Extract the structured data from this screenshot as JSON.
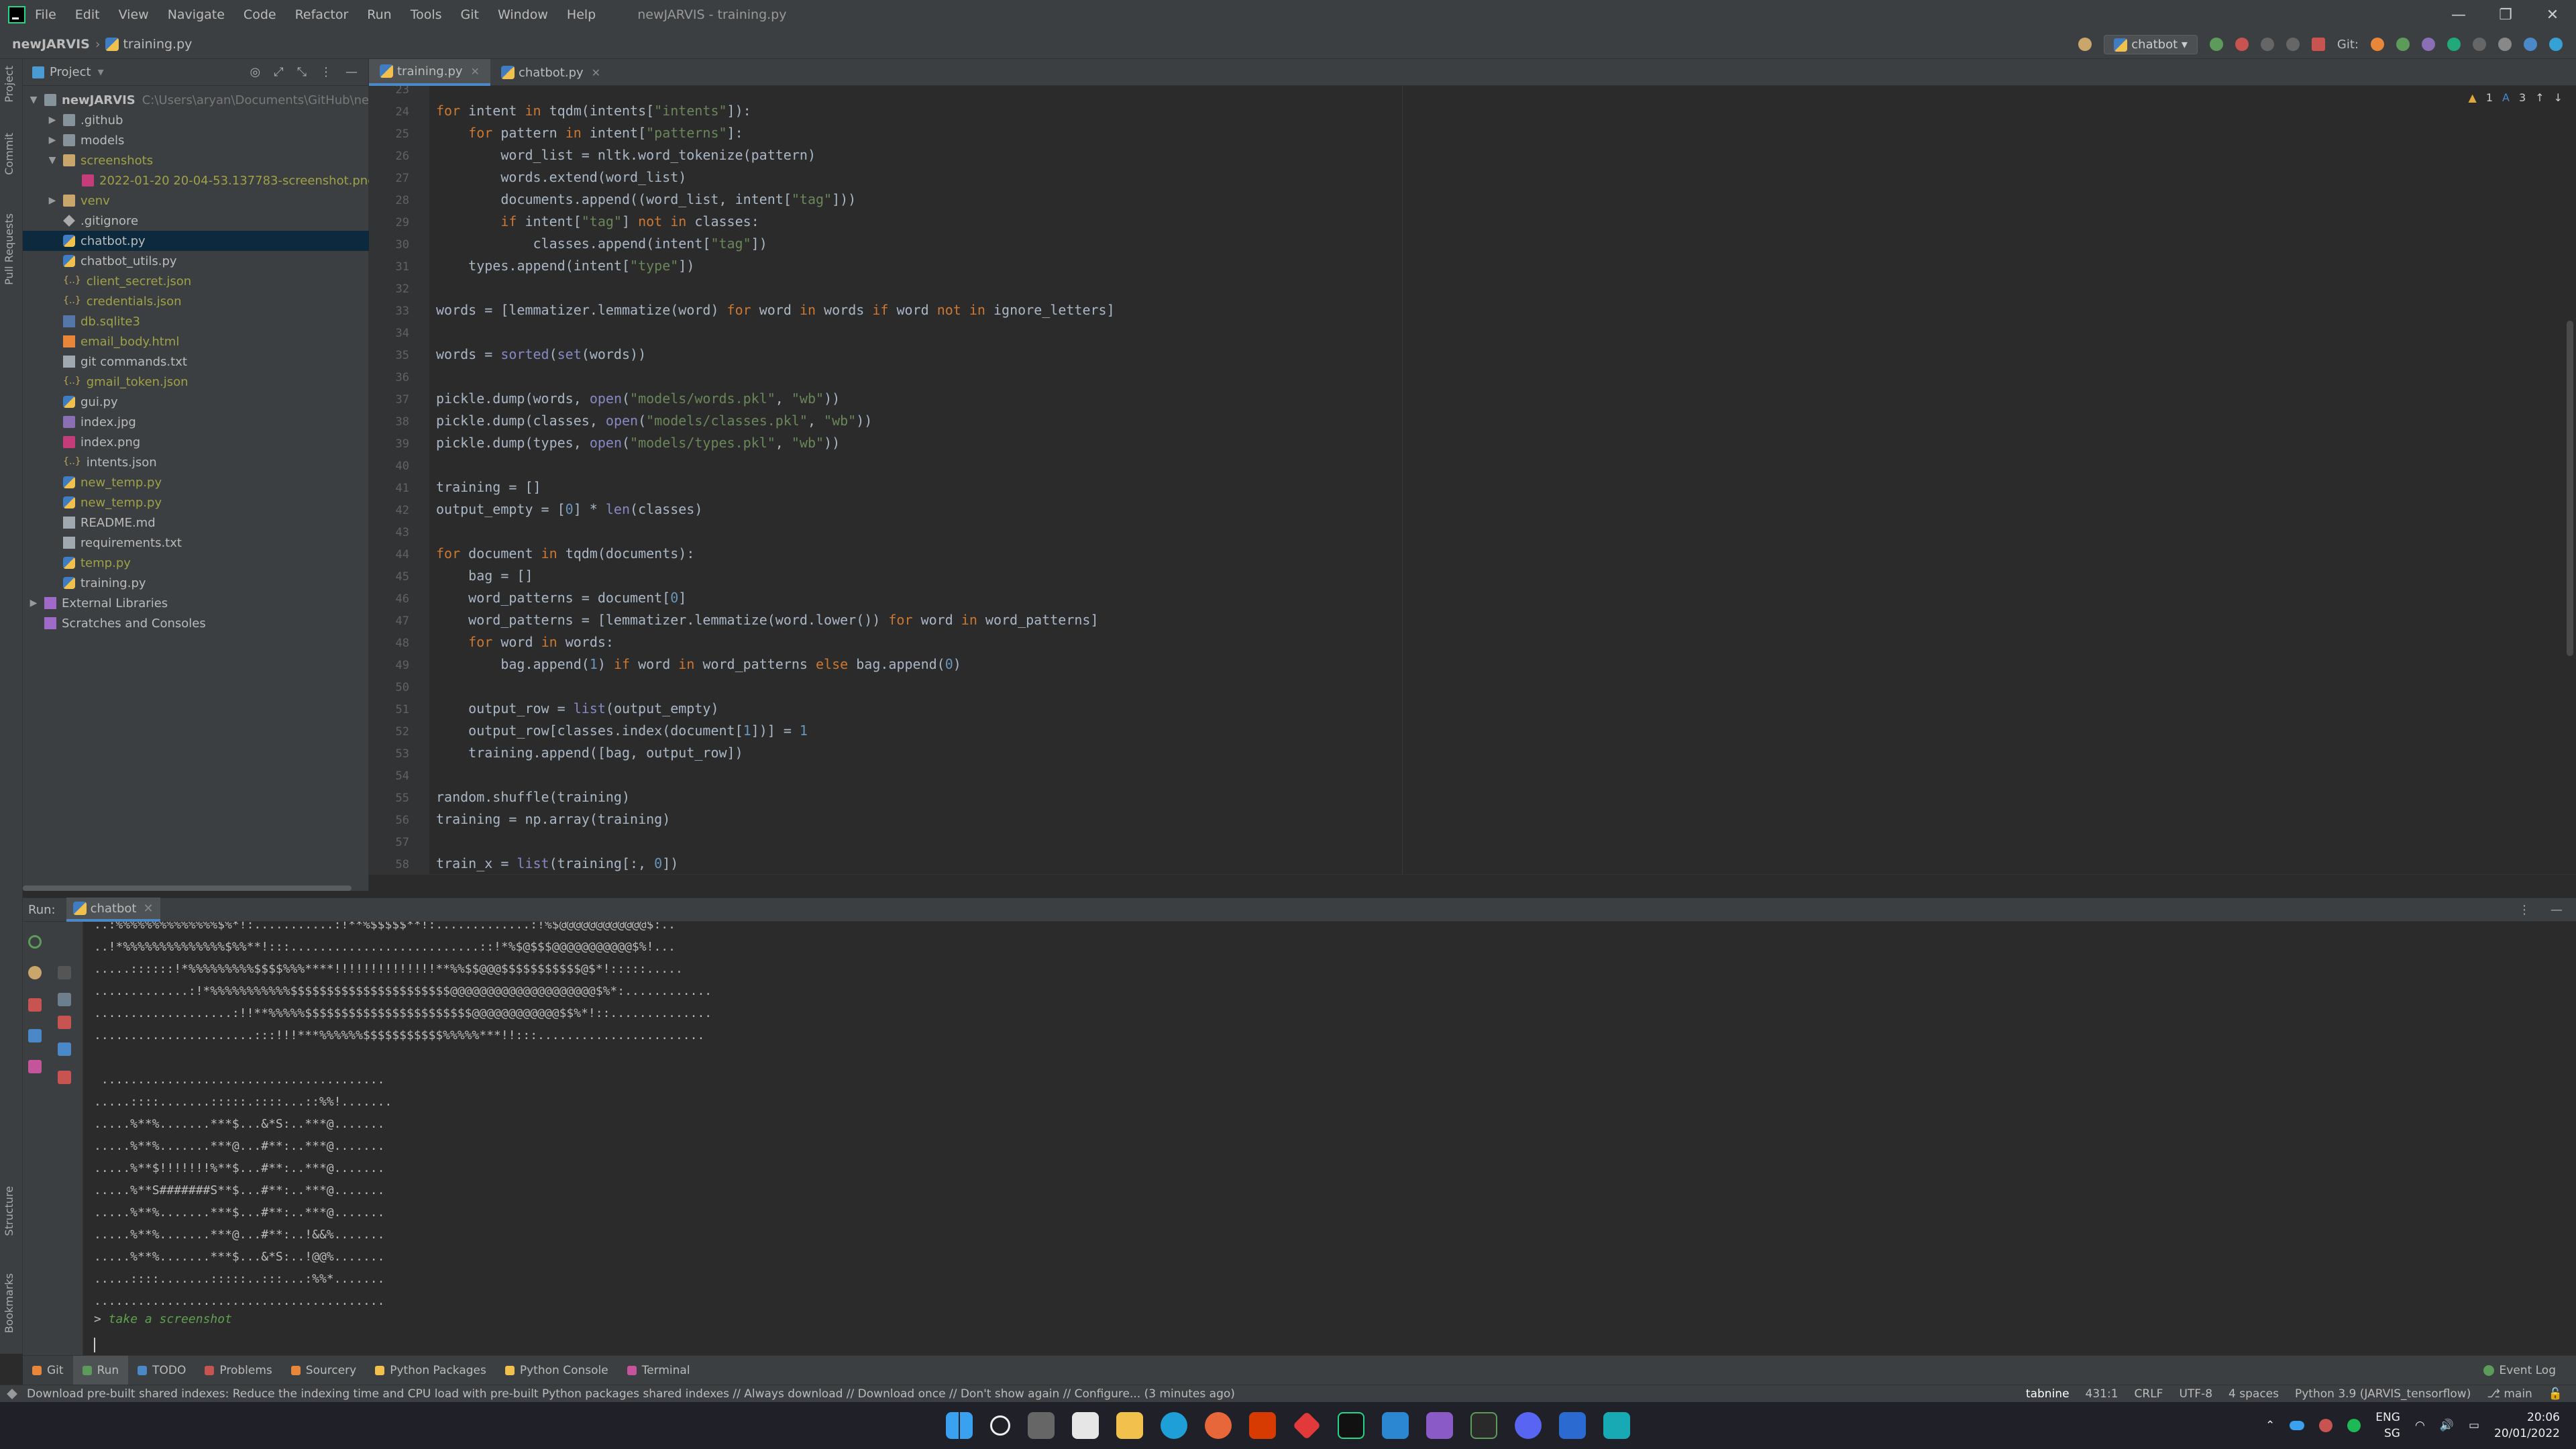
{
  "window": {
    "title": "newJARVIS - training.py",
    "menu": [
      "File",
      "Edit",
      "View",
      "Navigate",
      "Code",
      "Refactor",
      "Run",
      "Tools",
      "Git",
      "Window",
      "Help"
    ],
    "controls": [
      "—",
      "❐",
      "✕"
    ]
  },
  "navbar": {
    "project": "newJARVIS",
    "file": "training.py",
    "run_config": "chatbot",
    "git_label": "Git:"
  },
  "left_strip": [
    "Project",
    "Commit",
    "Pull Requests",
    "Structure",
    "Bookmarks"
  ],
  "project_panel": {
    "header": "Project",
    "tree": [
      {
        "label": "newJARVIS",
        "note": "C:\\Users\\aryan\\Documents\\GitHub\\newJARVIS",
        "indent": 0,
        "arrow": "▼",
        "icon": "folder",
        "style": "bold"
      },
      {
        "label": ".github",
        "indent": 1,
        "arrow": "▶",
        "icon": "folder"
      },
      {
        "label": "models",
        "indent": 1,
        "arrow": "▶",
        "icon": "folder"
      },
      {
        "label": "screenshots",
        "indent": 1,
        "arrow": "▼",
        "icon": "folder-orange",
        "style": "yellow"
      },
      {
        "label": "2022-01-20 20-04-53.137783-screenshot.png",
        "indent": 2,
        "arrow": "",
        "icon": "png",
        "style": "yellow"
      },
      {
        "label": "venv",
        "indent": 1,
        "arrow": "▶",
        "icon": "folder-orange",
        "style": "yellow"
      },
      {
        "label": ".gitignore",
        "indent": 1,
        "arrow": "",
        "icon": "git"
      },
      {
        "label": "chatbot.py",
        "indent": 1,
        "arrow": "",
        "icon": "py",
        "selected": true
      },
      {
        "label": "chatbot_utils.py",
        "indent": 1,
        "arrow": "",
        "icon": "py"
      },
      {
        "label": "client_secret.json",
        "indent": 1,
        "arrow": "",
        "icon": "json",
        "style": "yellow"
      },
      {
        "label": "credentials.json",
        "indent": 1,
        "arrow": "",
        "icon": "json",
        "style": "yellow"
      },
      {
        "label": "db.sqlite3",
        "indent": 1,
        "arrow": "",
        "icon": "db",
        "style": "yellow"
      },
      {
        "label": "email_body.html",
        "indent": 1,
        "arrow": "",
        "icon": "html",
        "style": "yellow"
      },
      {
        "label": "git commands.txt",
        "indent": 1,
        "arrow": "",
        "icon": "txt"
      },
      {
        "label": "gmail_token.json",
        "indent": 1,
        "arrow": "",
        "icon": "json",
        "style": "yellow"
      },
      {
        "label": "gui.py",
        "indent": 1,
        "arrow": "",
        "icon": "py"
      },
      {
        "label": "index.jpg",
        "indent": 1,
        "arrow": "",
        "icon": "img"
      },
      {
        "label": "index.png",
        "indent": 1,
        "arrow": "",
        "icon": "png"
      },
      {
        "label": "intents.json",
        "indent": 1,
        "arrow": "",
        "icon": "json"
      },
      {
        "label": "new_temp.py",
        "indent": 1,
        "arrow": "",
        "icon": "py",
        "style": "yellow"
      },
      {
        "label": "new_temp.py",
        "indent": 1,
        "arrow": "",
        "icon": "py",
        "style": "yellow"
      },
      {
        "label": "README.md",
        "indent": 1,
        "arrow": "",
        "icon": "txt"
      },
      {
        "label": "requirements.txt",
        "indent": 1,
        "arrow": "",
        "icon": "txt"
      },
      {
        "label": "temp.py",
        "indent": 1,
        "arrow": "",
        "icon": "py",
        "style": "yellow"
      },
      {
        "label": "training.py",
        "indent": 1,
        "arrow": "",
        "icon": "py"
      },
      {
        "label": "External Libraries",
        "indent": 0,
        "arrow": "▶",
        "icon": "lib"
      },
      {
        "label": "Scratches and Consoles",
        "indent": 0,
        "arrow": "",
        "icon": "lib"
      }
    ]
  },
  "editor": {
    "tabs": [
      {
        "label": "training.py",
        "active": true
      },
      {
        "label": "chatbot.py",
        "active": false
      }
    ],
    "inspection": {
      "warnings": "1",
      "typos": "3"
    },
    "first_line": 23,
    "lines": [
      "",
      "for intent in tqdm(intents[\"intents\"]):",
      "    for pattern in intent[\"patterns\"]:",
      "        word_list = nltk.word_tokenize(pattern)",
      "        words.extend(word_list)",
      "        documents.append((word_list, intent[\"tag\"]))",
      "        if intent[\"tag\"] not in classes:",
      "            classes.append(intent[\"tag\"])",
      "    types.append(intent[\"type\"])",
      "",
      "words = [lemmatizer.lemmatize(word) for word in words if word not in ignore_letters]",
      "",
      "words = sorted(set(words))",
      "",
      "pickle.dump(words, open(\"models/words.pkl\", \"wb\"))",
      "pickle.dump(classes, open(\"models/classes.pkl\", \"wb\"))",
      "pickle.dump(types, open(\"models/types.pkl\", \"wb\"))",
      "",
      "training = []",
      "output_empty = [0] * len(classes)",
      "",
      "for document in tqdm(documents):",
      "    bag = []",
      "    word_patterns = document[0]",
      "    word_patterns = [lemmatizer.lemmatize(word.lower()) for word in word_patterns]",
      "    for word in words:",
      "        bag.append(1) if word in word_patterns else bag.append(0)",
      "",
      "    output_row = list(output_empty)",
      "    output_row[classes.index(document[1])] = 1",
      "    training.append([bag, output_row])",
      "",
      "random.shuffle(training)",
      "training = np.array(training)",
      "",
      "train_x = list(training[:, 0])"
    ]
  },
  "run_panel": {
    "label": "Run:",
    "tab": "chatbot",
    "console": [
      "..:%%%%%%%%%%%%%%$%*!:...........:!**%$$$$$**!:.............:!%$@@@@@@@@@@@@$:..",
      "..!*%%%%%%%%%%%%%%$%%**!:::..........................::!*%$@$$$@@@@@@@@@@@$%!...",
      ".....::::::!*%%%%%%%%%$$$$%%%****!!!!!!!!!!!!!!**%%$$@@@$$$$$$$$$$$@$*!:::::.....",
      ".............:!*%%%%%%%%%%%$$$$$$$$$$$$$$$$$$$$$$@@@@@@@@@@@@@@@@@@@@$%*:............",
      "...................:!!**%%%%%$$$$$$$$$$$$$$$$$$$$$$$@@@@@@@@@@@@$$%*!::..............",
      "......................:::!!!***%%%%%%$$$$$$$$$$$%%%%%***!!:::.......................",
      "",
      " .......................................",
      ".....::::.......:::::.::::...::%%!.......",
      ".....%**%.......***$...&*S:..***@.......",
      ".....%**%.......***@...#**:..***@.......",
      ".....%**$!!!!!!!%**$...#**:..***@.......",
      ".....%**S#######S**$...#**:..***@.......",
      ".....%**%.......***$...#**:..***@.......",
      ".....%**%.......***@...#**:..!&&%.......",
      ".....%**%.......***$...&*S:..!@@%.......",
      ".....::::.......:::::..:::...:%%*.......",
      "........................................"
    ],
    "prompt": "> ",
    "input": "take a screenshot"
  },
  "tool_tabs": [
    "Git",
    "Run",
    "TODO",
    "Problems",
    "Sourcery",
    "Python Packages",
    "Python Console",
    "Terminal"
  ],
  "event_log": "Event Log",
  "status": {
    "message": "Download pre-built shared indexes: Reduce the indexing time and CPU load with pre-built Python packages shared indexes // Always download // Download once // Don't show again // Configure... (3 minutes ago)",
    "tabnine": "tabnine",
    "position": "431:1",
    "line_sep": "CRLF",
    "encoding": "UTF-8",
    "indent": "4 spaces",
    "interpreter": "Python 3.9 (JARVIS_tensorflow)",
    "branch": "main"
  },
  "taskbar": {
    "lang": "ENG",
    "region": "SG",
    "time": "20:06",
    "date": "20/01/2022"
  },
  "colors": {
    "accent": "#4a88c7",
    "bg": "#2b2b2b",
    "panel": "#3c3f41",
    "keyword": "#cc7832",
    "string": "#6a8759"
  }
}
